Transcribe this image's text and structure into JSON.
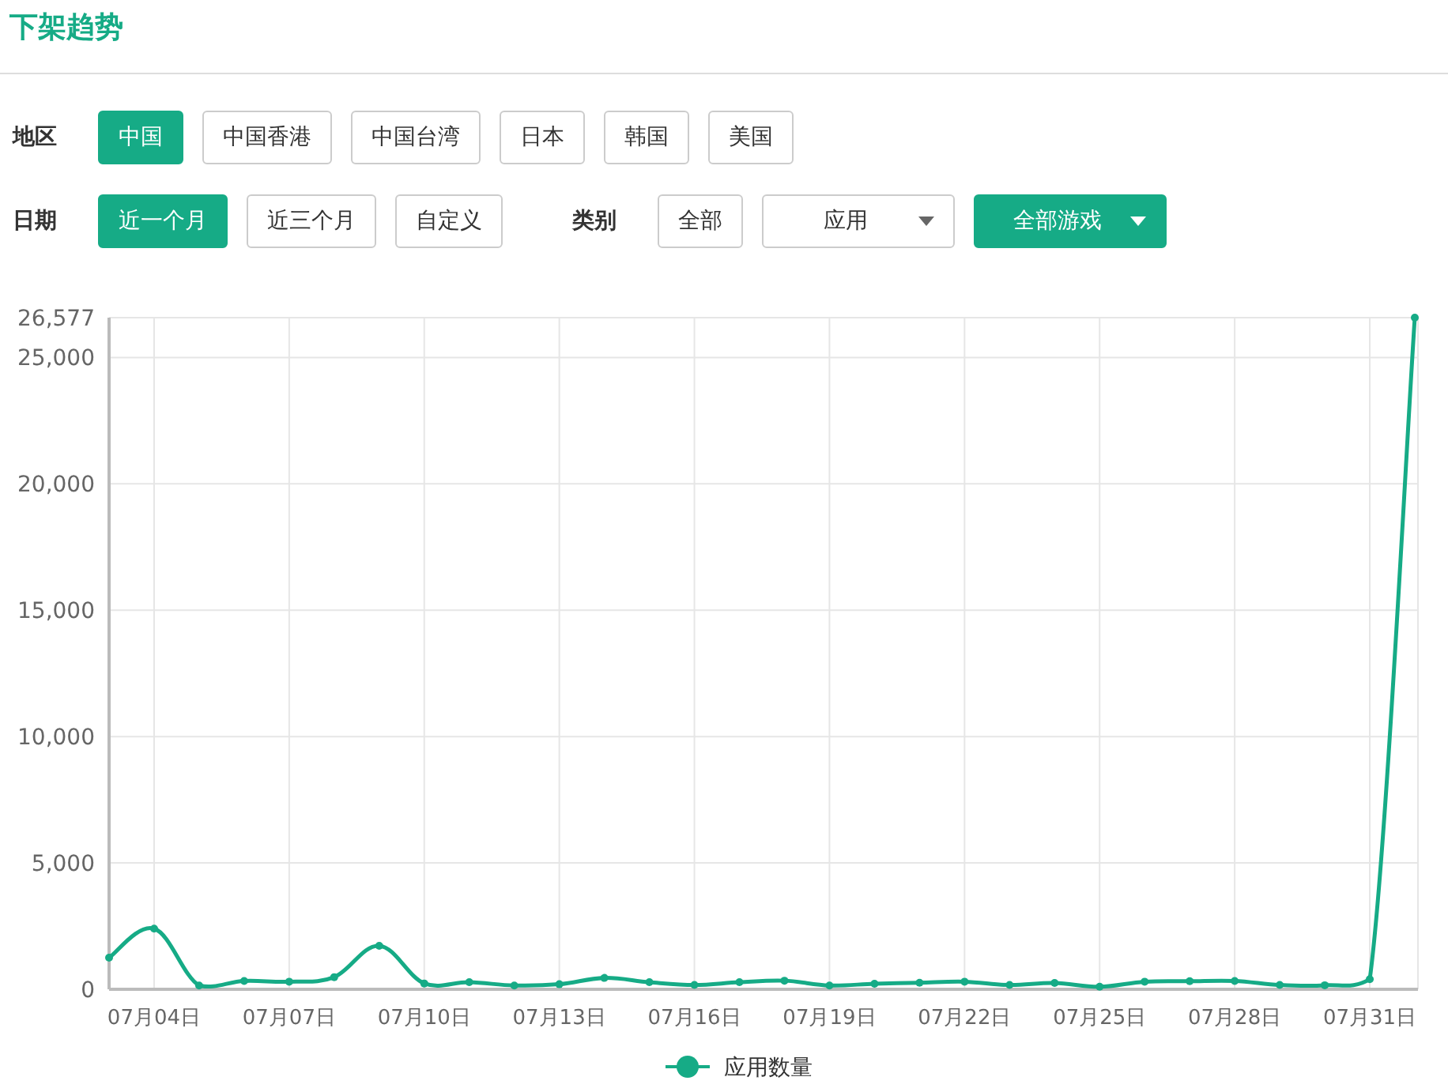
{
  "title": "下架趋势",
  "filter_rows": [
    {
      "groups": [
        {
          "label": "地区",
          "options": [
            {
              "kind": "button",
              "label": "中国",
              "selected": true
            },
            {
              "kind": "button",
              "label": "中国香港",
              "selected": false
            },
            {
              "kind": "button",
              "label": "中国台湾",
              "selected": false
            },
            {
              "kind": "button",
              "label": "日本",
              "selected": false
            },
            {
              "kind": "button",
              "label": "韩国",
              "selected": false
            },
            {
              "kind": "button",
              "label": "美国",
              "selected": false
            }
          ]
        }
      ]
    },
    {
      "groups": [
        {
          "label": "日期",
          "options": [
            {
              "kind": "button",
              "label": "近一个月",
              "selected": true
            },
            {
              "kind": "button",
              "label": "近三个月",
              "selected": false
            },
            {
              "kind": "button",
              "label": "自定义",
              "selected": false
            }
          ]
        },
        {
          "label": "类别",
          "options": [
            {
              "kind": "button",
              "label": "全部",
              "selected": false
            },
            {
              "kind": "dropdown",
              "label": "应用",
              "selected": false
            },
            {
              "kind": "dropdown",
              "label": "全部游戏",
              "selected": true
            }
          ]
        }
      ]
    }
  ],
  "chart": {
    "chart_data": {
      "type": "line",
      "grid": true,
      "categories": [
        null,
        "07月04日",
        null,
        null,
        "07月07日",
        null,
        null,
        "07月10日",
        null,
        null,
        "07月13日",
        null,
        null,
        "07月16日",
        null,
        null,
        "07月19日",
        null,
        null,
        "07月22日",
        null,
        null,
        "07月25日",
        null,
        null,
        "07月28日",
        null,
        null,
        "07月31日",
        null
      ],
      "ylim": [
        0,
        26577
      ],
      "yticks": [
        {
          "value": 0,
          "label": "0"
        },
        {
          "value": 5000,
          "label": "5,000"
        },
        {
          "value": 10000,
          "label": "10,000"
        },
        {
          "value": 15000,
          "label": "15,000"
        },
        {
          "value": 20000,
          "label": "20,000"
        },
        {
          "value": 25000,
          "label": "25,000"
        },
        {
          "value": 26577,
          "label": "26,577"
        }
      ],
      "series": [
        {
          "name": "应用数量",
          "color": "#16ab86",
          "marker": "circle",
          "values": [
            1250,
            2400,
            150,
            330,
            300,
            480,
            1720,
            230,
            280,
            150,
            200,
            450,
            280,
            170,
            280,
            340,
            150,
            220,
            260,
            300,
            170,
            250,
            100,
            300,
            320,
            330,
            170,
            160,
            400,
            26577
          ]
        }
      ]
    }
  }
}
